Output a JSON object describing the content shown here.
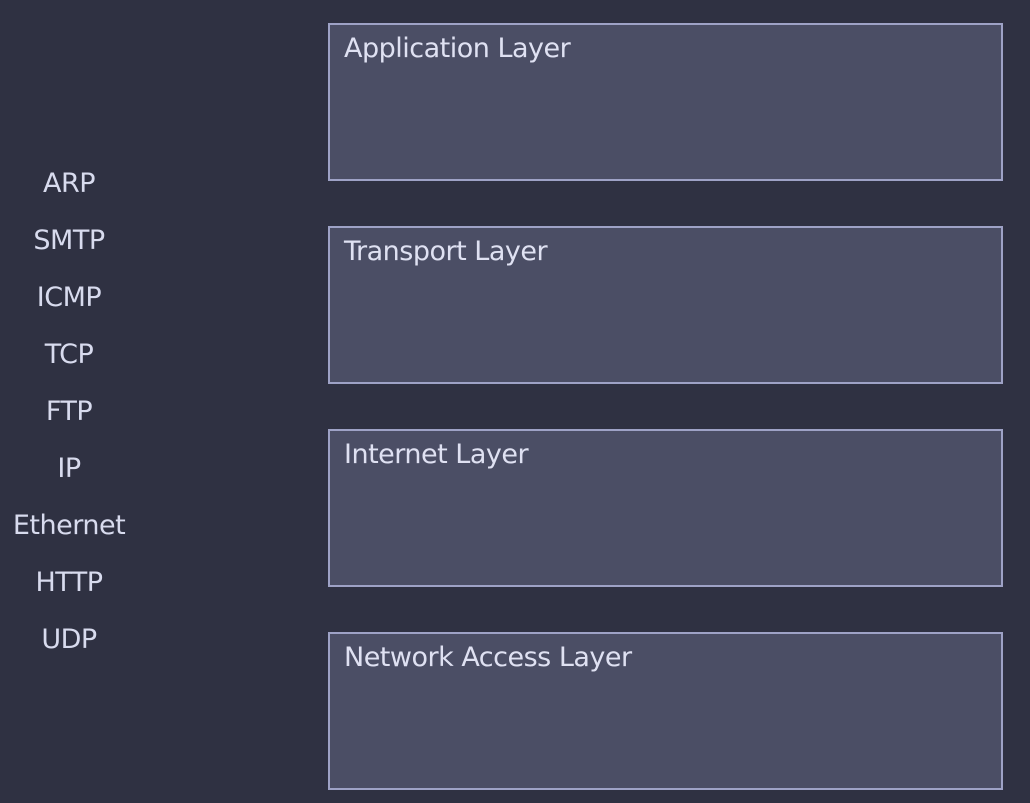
{
  "protocols": [
    {
      "label": "ARP"
    },
    {
      "label": "SMTP"
    },
    {
      "label": "ICMP"
    },
    {
      "label": "TCP"
    },
    {
      "label": "FTP"
    },
    {
      "label": "IP"
    },
    {
      "label": "Ethernet"
    },
    {
      "label": "HTTP"
    },
    {
      "label": "UDP"
    }
  ],
  "layers": [
    {
      "label": "Application Layer"
    },
    {
      "label": "Transport Layer"
    },
    {
      "label": "Internet Layer"
    },
    {
      "label": "Network Access Layer"
    }
  ],
  "colors": {
    "background": "#2f3142",
    "box_fill": "#4b4e65",
    "box_border": "#9ea2c6",
    "text": "#d8dbee"
  }
}
